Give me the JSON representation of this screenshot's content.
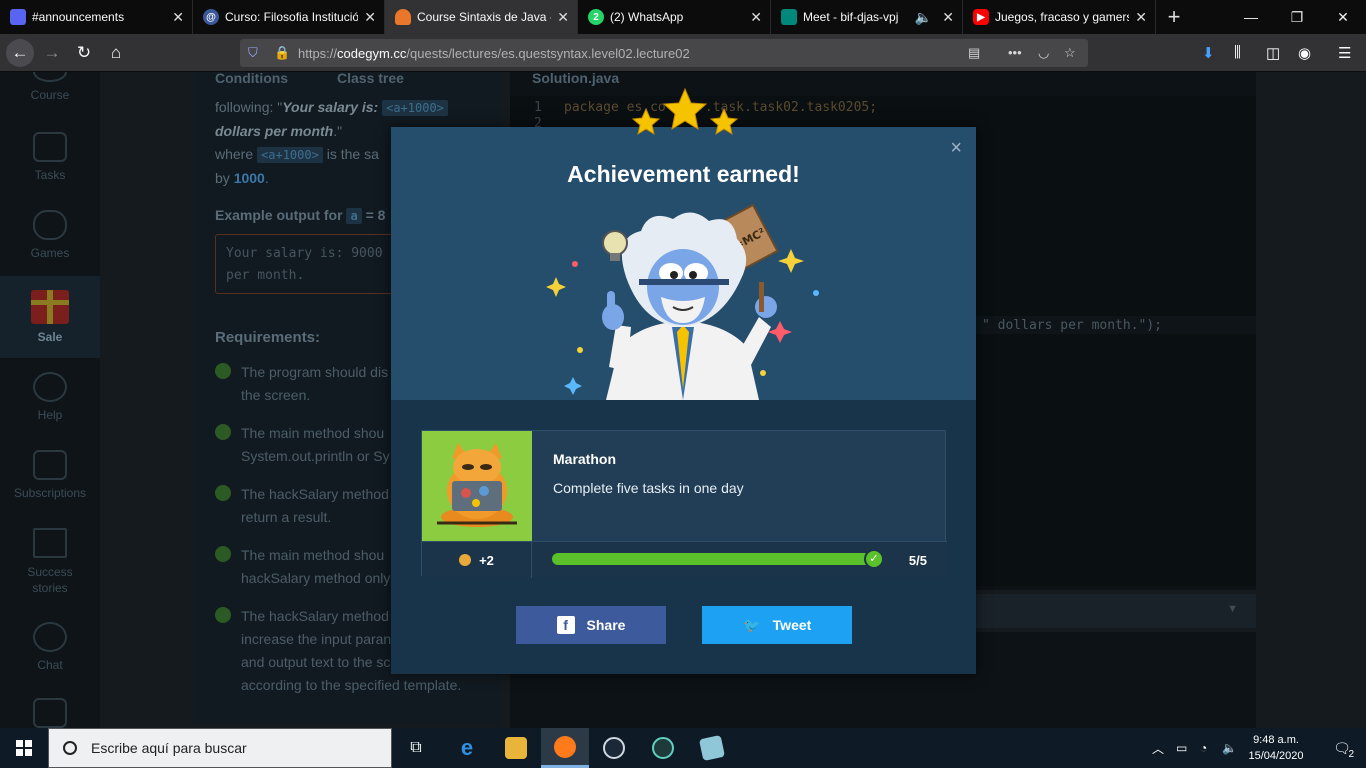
{
  "browser": {
    "tabs": [
      {
        "title": "#announcements",
        "favicon_color": "#5865f2"
      },
      {
        "title": "Curso: Filosofia Institució",
        "favicon_color": "#3b5998"
      },
      {
        "title": "Course Sintaxis de Java -",
        "favicon_color": "#e8762b",
        "active": true
      },
      {
        "title": "(2) WhatsApp",
        "favicon_color": "#25d366",
        "badge": "2"
      },
      {
        "title": "Meet - bif-djas-vpj",
        "favicon_color": "#00897b"
      },
      {
        "title": "Juegos, fracaso y gamers",
        "favicon_color": "#ff0000"
      }
    ],
    "url_prefix": "https://",
    "url_host": "codegym.cc",
    "url_path": "/quests/lectures/es.questsyntax.level02.lecture02"
  },
  "sidebar": {
    "items": [
      {
        "label": "Course"
      },
      {
        "label": "Tasks"
      },
      {
        "label": "Games"
      },
      {
        "label": "Sale"
      },
      {
        "label": "Help"
      },
      {
        "label": "Subscriptions"
      },
      {
        "label": "Success stories"
      },
      {
        "label": "Chat"
      }
    ]
  },
  "task": {
    "tab_conditions": "Conditions",
    "tab_class_tree": "Class tree",
    "line1_prefix": "following: \"",
    "line1_bold": "Your salary is: ",
    "line1_code": "<a+1000>",
    "line2_bold": "dollars per month",
    "line2_suffix": ".\"",
    "line3_prefix": "where ",
    "line3_code": "<a+1000>",
    "line3_suffix": " is the sa",
    "line4_prefix": "by ",
    "line4_num": "1000",
    "line4_suffix": ".",
    "example_label": "Example output for ",
    "example_code": "a",
    "example_suffix": " = 8",
    "output_line1": "Your salary is: 9000",
    "output_line2": "per month.",
    "requirements_title": "Requirements:",
    "requirements": [
      {
        "l1": "The program should dis",
        "l2": "the screen."
      },
      {
        "l1": "The main method shou",
        "l2": "System.out.println or Sy"
      },
      {
        "l1": "The hackSalary method",
        "l2": "return a result."
      },
      {
        "l1": "The main method shou",
        "l2": "hackSalary method only"
      },
      {
        "l1": "The hackSalary method",
        "l2": "increase the input paran",
        "l3": "and output text to the sc",
        "l4": "according to the specified template."
      }
    ]
  },
  "editor": {
    "filename": "Solution.java",
    "line_numbers": [
      "1",
      "2"
    ],
    "line1": "package es.co     .task.task02.task0205;",
    "line_visible": "\" dollars per month.\");"
  },
  "modal": {
    "title": "Achievement earned!",
    "close": "×",
    "achievement_title": "Marathon",
    "achievement_desc": "Complete five tasks in one day",
    "reward": "+2",
    "progress": 1.0,
    "progress_text": "5/5",
    "share_label": "Share",
    "tweet_label": "Tweet",
    "sign_text": "E=MC²"
  },
  "taskbar": {
    "search_placeholder": "Escribe aquí para buscar",
    "time": "9:48 a.m.",
    "date": "15/04/2020",
    "notif_count": "2"
  }
}
